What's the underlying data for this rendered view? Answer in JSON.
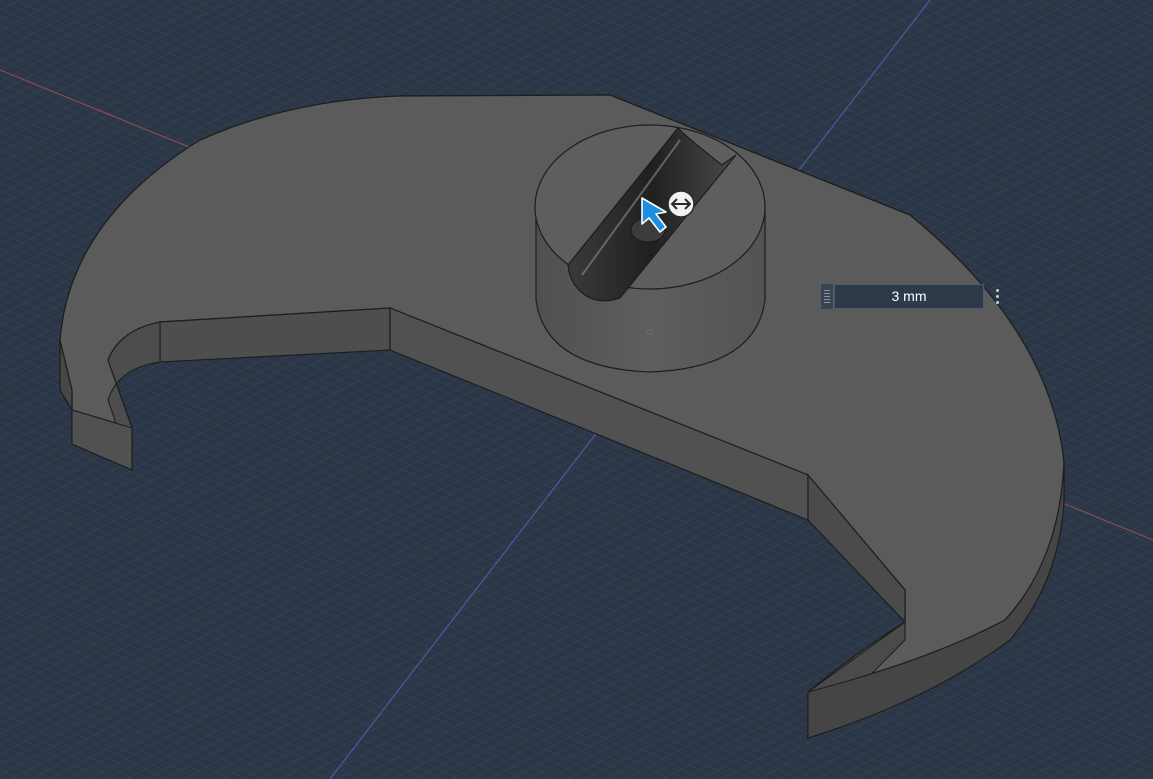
{
  "viewport": {
    "background_color": "#2b3646",
    "grid_color": "#44536a",
    "axis_x_color": "#8a4a52",
    "axis_y_color": "#4a5aa0",
    "body_color": "#5a5a5a",
    "body_side_color": "#4a4a4a"
  },
  "dimension_input": {
    "value": "3 mm",
    "menu_icon": "vertical-ellipsis-icon",
    "grip_icon": "drag-grip-icon"
  },
  "cursor": {
    "icon": "move-cursor-icon",
    "badge_icon": "move-handle-icon"
  }
}
